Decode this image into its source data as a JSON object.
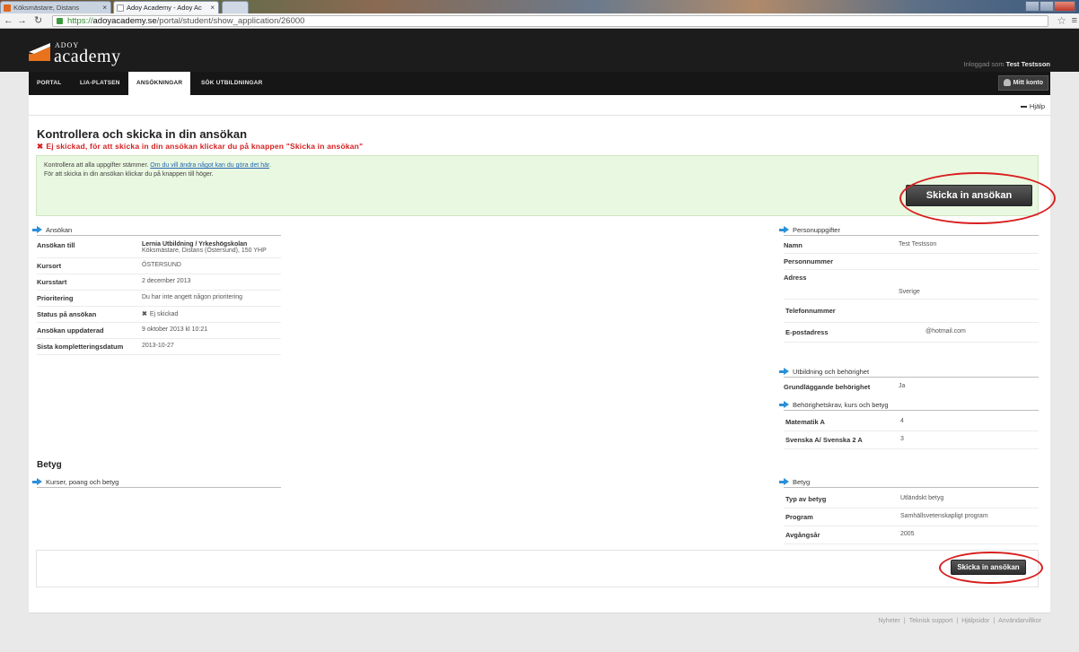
{
  "browser": {
    "tabs": [
      {
        "title": "Köksmästare, Distans"
      },
      {
        "title": "Adoy Academy - Adoy Ac"
      }
    ],
    "url": {
      "scheme": "https://",
      "host": "adoyacademy.se",
      "path": "/portal/student/show_application/26000"
    }
  },
  "header": {
    "logo_top": "ADOY",
    "logo_main": "academy",
    "logged_in_prefix": "Inloggad som",
    "logged_in_user": "Test Testsson"
  },
  "nav": {
    "items": [
      "PORTAL",
      "LIA-PLATSEN",
      "ANSÖKNINGAR",
      "SÖK UTBILDNINGAR"
    ],
    "active": "ANSÖKNINGAR",
    "account": "Mitt konto"
  },
  "page": {
    "help": "Hjälp",
    "title": "Kontrollera och skicka in din ansökan",
    "warning": "Ej skickad, för att skicka in din ansökan klickar du på knappen \"Skicka in ansökan\"",
    "info_line1_prefix": "Kontrollera att alla uppgifter stämmer.",
    "info_line1_link": "Om du vill ändra något kan du göra det här",
    "info_line1_suffix": ".",
    "info_line2": "För att skicka in din ansökan klickar du på knappen till höger.",
    "submit_button": "Skicka in ansökan",
    "submit_button_small": "Skicka in ansökan"
  },
  "application": {
    "title": "Ansökan",
    "rows": [
      {
        "k": "Ansökan till",
        "v_bold": "Lernia Utbildning / Yrkeshögskolan",
        "v": "Köksmästare, Distans (Östersund), 150 YHP"
      },
      {
        "k": "Kursort",
        "v": "ÖSTERSUND"
      },
      {
        "k": "Kursstart",
        "v": "2 december 2013"
      },
      {
        "k": "Prioritering",
        "v": "Du har inte angett någon prioritering"
      },
      {
        "k": "Status på ansökan",
        "v": "Ej skickad"
      },
      {
        "k": "Ansökan uppdaterad",
        "v": "9 oktober 2013 kl 10:21"
      },
      {
        "k": "Sista kompletteringsdatum",
        "v": "2013-10-27"
      }
    ]
  },
  "personal": {
    "title": "Personuppgifter",
    "rows": [
      {
        "k": "Namn",
        "v": "Test Testsson"
      },
      {
        "k": "Personnummer",
        "v": ""
      },
      {
        "k": "Adress",
        "v": ""
      },
      {
        "k": "",
        "v": "Sverige"
      },
      {
        "k": "Telefonnummer",
        "v": ""
      },
      {
        "k": "E-postadress",
        "v": "@hotmail.com"
      }
    ]
  },
  "education": {
    "title": "Utbildning och behörighet",
    "rows": [
      {
        "k": "Grundläggande behörighet",
        "v": "Ja"
      }
    ]
  },
  "requirements": {
    "title": "Behörighetskrav, kurs och betyg",
    "rows": [
      {
        "k": "Matematik A",
        "v": "4"
      },
      {
        "k": "Svenska A/ Svenska 2 A",
        "v": "3"
      }
    ]
  },
  "grades_section": {
    "heading": "Betyg",
    "courses_title": "Kurser, poang och betyg"
  },
  "grades": {
    "title": "Betyg",
    "rows": [
      {
        "k": "Typ av betyg",
        "v": "Utländskt betyg"
      },
      {
        "k": "Program",
        "v": "Samhällsvetenskapligt program"
      },
      {
        "k": "Avgångsår",
        "v": "2005"
      }
    ]
  },
  "footer": [
    "Nyheter",
    "Teknisk support",
    "Hjälpsidor",
    "Användarvillkor"
  ]
}
